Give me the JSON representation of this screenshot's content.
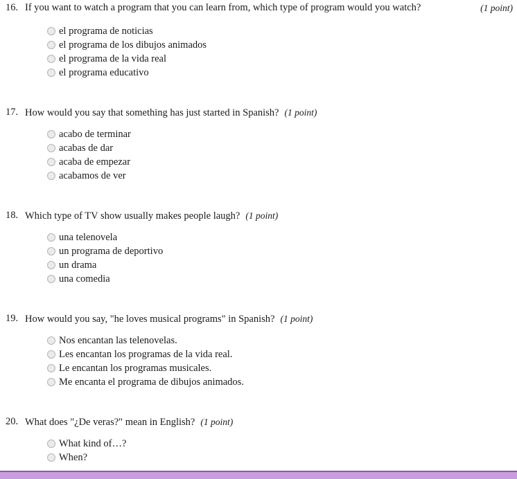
{
  "page": {
    "footer_color": "#c89ede",
    "footer_border_color": "#8a5aa8",
    "radio_fill": "#eceaea",
    "radio_border": "#b4b4b4"
  },
  "questions": [
    {
      "number": "16.",
      "text": "If you want to watch a program that you can learn from, which type of program would you watch?",
      "points": "(1 point)",
      "options": [
        "el programa de noticias",
        "el programa de los dibujos animados",
        "el programa de la vida real",
        "el programa educativo"
      ]
    },
    {
      "number": "17.",
      "text": "How would you say that something has just started in Spanish?",
      "points": "(1 point)",
      "options": [
        "acabo de terminar",
        "acabas de dar",
        "acaba de empezar",
        "acabamos de ver"
      ]
    },
    {
      "number": "18.",
      "text": "Which type of TV show usually makes people laugh?",
      "points": "(1 point)",
      "options": [
        "una telenovela",
        "un programa de deportivo",
        "un drama",
        "una comedia"
      ]
    },
    {
      "number": "19.",
      "text": "How would you say, \"he loves musical programs\" in Spanish?",
      "points": "(1 point)",
      "options": [
        "Nos encantan las telenovelas.",
        "Les encantan los programas de la vida real.",
        "Le encantan los programas musicales.",
        "Me encanta el programa de dibujos animados."
      ]
    },
    {
      "number": "20.",
      "text": "What does \"¿De veras?\" mean in English?",
      "points": "(1 point)",
      "options": [
        "What kind of…?",
        "When?"
      ]
    }
  ]
}
